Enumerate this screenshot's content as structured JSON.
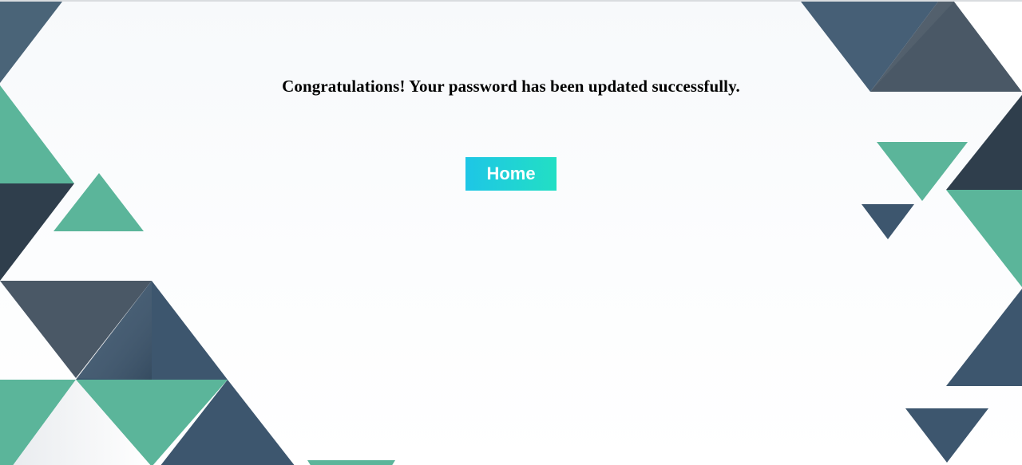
{
  "main": {
    "message": "Congratulations! Your password has been updated successfully.",
    "home_button_label": "Home"
  },
  "colors": {
    "navy": "#3d566e",
    "slate": "#4a5866",
    "dark": "#2f3e4c",
    "teal": "#5bb59a",
    "button_start": "#1ec6e6",
    "button_end": "#22dfc4"
  },
  "background": {
    "pattern": "geometric-triangles"
  }
}
